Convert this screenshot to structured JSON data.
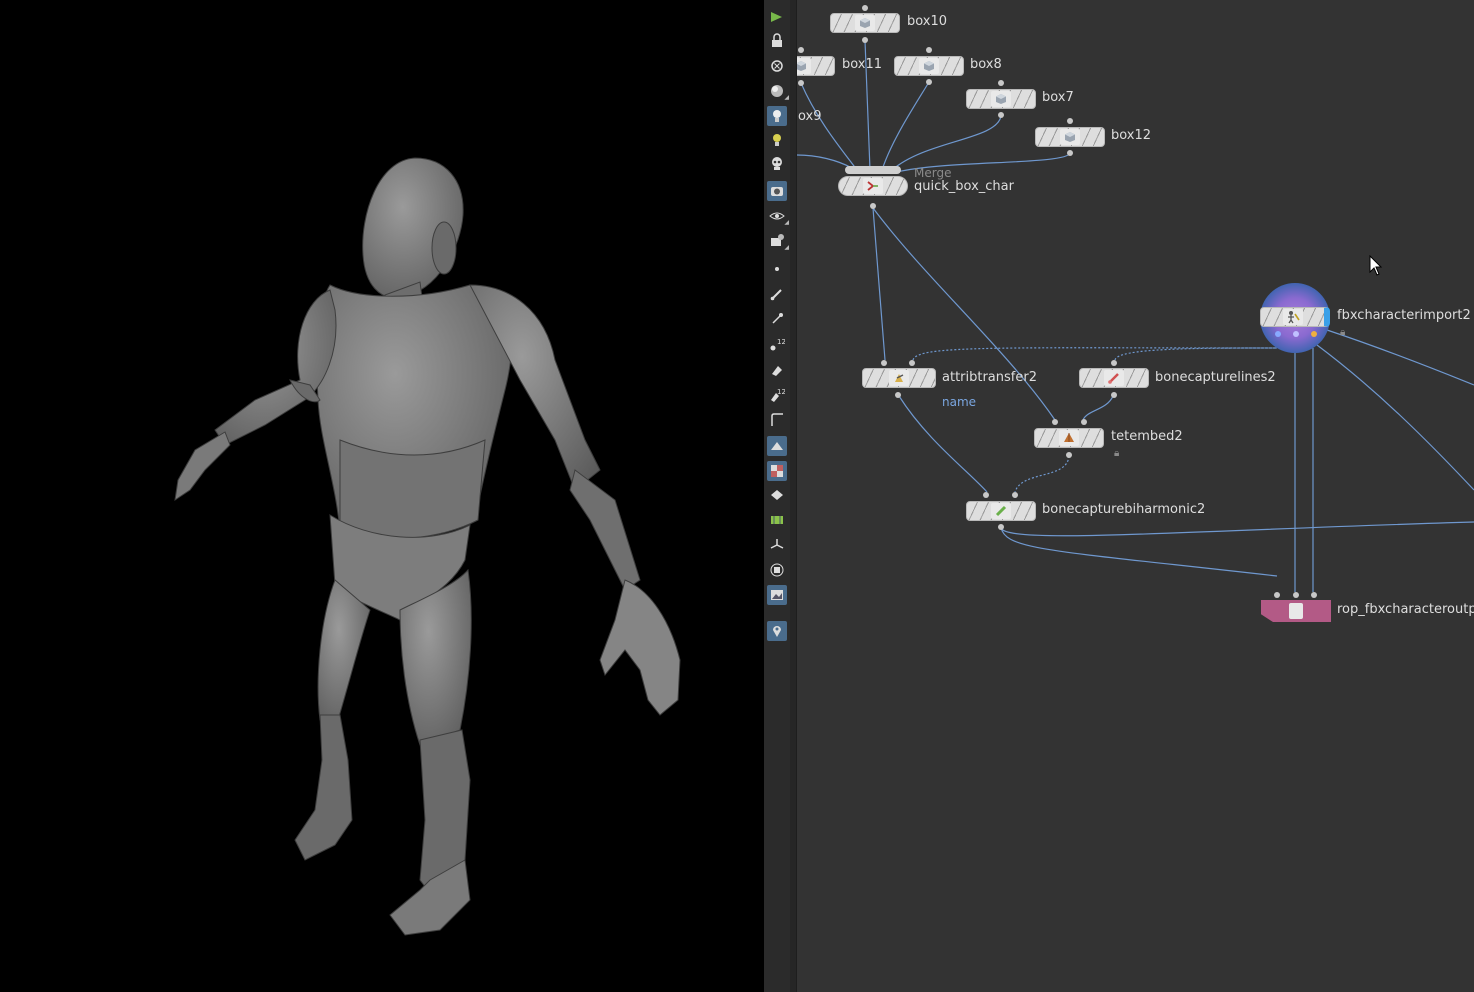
{
  "viewport": {
    "subject": "grey-mannequin"
  },
  "toolbar": {
    "tools": [
      "select-icon",
      "lock-icon",
      "ghost-icon",
      "shading-icon",
      "light-icon",
      "bulb-icon",
      "skull-icon",
      "camera-icon",
      "eye-icon",
      "render-icon",
      "point-icon",
      "brush-icon",
      "pen-icon",
      "points-12-icon",
      "paint-icon",
      "paint-12-icon",
      "corner-icon",
      "surface-icon",
      "checker-icon",
      "layer-icon",
      "map-icon",
      "axis-icon",
      "box-icon",
      "image-icon",
      "pin-icon"
    ]
  },
  "network": {
    "nodes": {
      "box10": "box10",
      "box11": "box11",
      "box8": "box8",
      "box9": "ox9",
      "box7": "box7",
      "box12": "box12",
      "merge_type": "Merge",
      "merge": "quick_box_char",
      "attribtransfer": "attribtransfer2",
      "attribtransfer_param": "name",
      "bonecapturelines": "bonecapturelines2",
      "tetembed": "tetembed2",
      "biharmonic": "bonecapturebiharmonic2",
      "fbximport": "fbxcharacterimport2",
      "rop": "rop_fbxcharacteroutput"
    }
  },
  "colors": {
    "bg": "#333333",
    "wire": "#6f98cf",
    "rop": "#b35a86",
    "param": "#7aa6e0"
  }
}
